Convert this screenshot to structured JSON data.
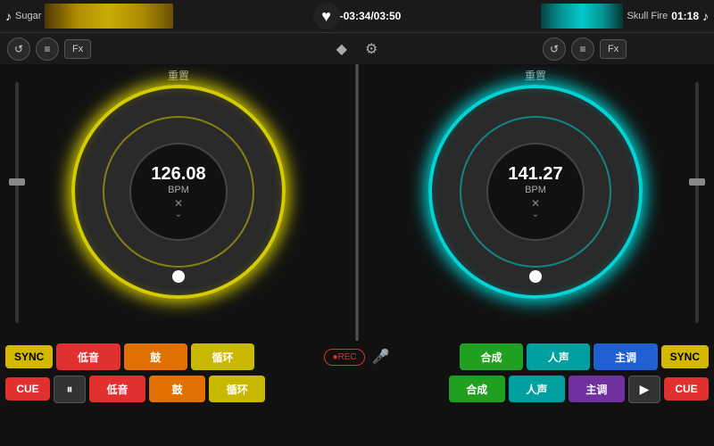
{
  "left_deck": {
    "song_title": "Sugar",
    "bpm": "126.08",
    "bpm_label": "BPM",
    "reset_label": "重置",
    "color": "yellow",
    "sync_label": "SYNC",
    "cue_label": "CUE",
    "pause_label": "⏸",
    "pads_row1": [
      "低音",
      "鼓",
      "循环",
      "合成",
      "人声",
      "主调"
    ],
    "pads_row2": [
      "低音",
      "鼓",
      "循环",
      "合成",
      "人声",
      "主调"
    ]
  },
  "right_deck": {
    "song_title": "Skull Fire",
    "bpm": "141.27",
    "bpm_label": "BPM",
    "reset_label": "重置",
    "color": "cyan",
    "sync_label": "SYNC",
    "cue_label": "CUE",
    "play_label": "▶",
    "pads_row1": [
      "低音",
      "鼓",
      "循环",
      "合成",
      "人声",
      "主调"
    ],
    "pads_row2": [
      "低音",
      "鼓",
      "循环",
      "合成",
      "人声",
      "主调"
    ]
  },
  "center": {
    "time": "-03:34/03:50",
    "right_time": "01:18",
    "rec_label": "●REC",
    "diamond_label": "◆",
    "gear_label": "⚙"
  },
  "controls": {
    "loop_left": "↺",
    "eq_left": "≡",
    "fx_left": "Fx",
    "loop_right": "↺",
    "eq_right": "≡",
    "fx_right": "Fx"
  },
  "pads": {
    "row1_colors": [
      "red",
      "orange",
      "yellow",
      "green",
      "teal",
      "blue",
      "purple",
      "magenta"
    ],
    "row2_colors": [
      "red",
      "orange",
      "yellow",
      "green",
      "teal",
      "blue",
      "purple",
      "magenta"
    ]
  }
}
